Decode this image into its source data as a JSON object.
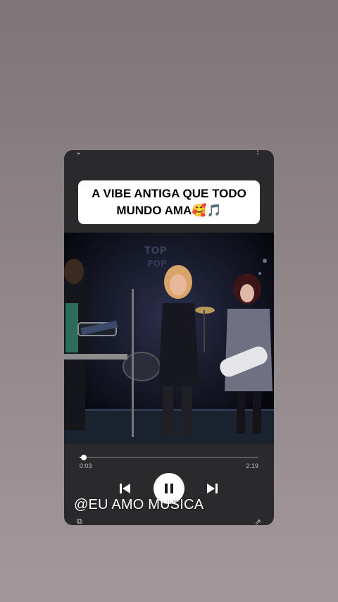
{
  "caption": {
    "line1": "A VIBE ANTIGA QUE TODO",
    "line2": "MUNDO AMA🥰🎵"
  },
  "player": {
    "current_time": "0:03",
    "total_time": "2:19",
    "progress_fraction": 0.022
  },
  "watermark": "@EU AMO MUSICA",
  "icons": {
    "top_left": "chevron-down-icon",
    "top_right": "more-icon",
    "prev": "skip-previous-icon",
    "play_pause": "pause-icon",
    "next": "skip-next-icon",
    "bottom_left": "caption-icon",
    "bottom_right": "share-icon"
  },
  "colors": {
    "card_bg": "#2a2a2c",
    "caption_bg": "#ffffff",
    "stage_bg": "#0c0d14"
  }
}
